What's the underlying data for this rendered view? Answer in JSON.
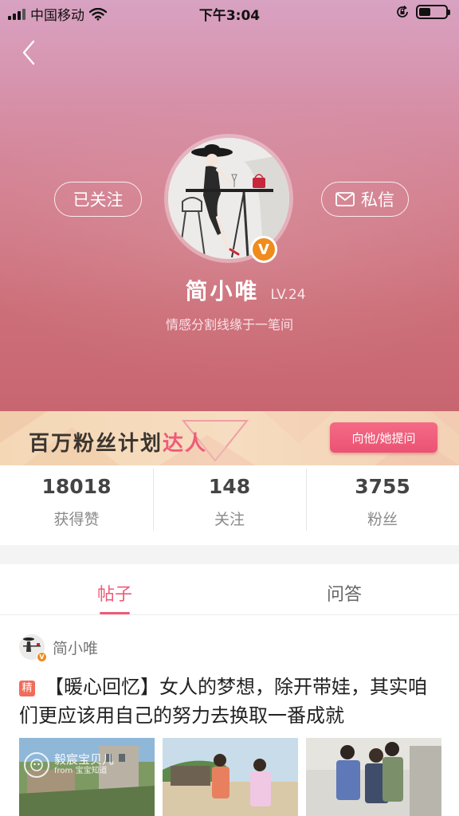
{
  "status_bar": {
    "carrier": "中国移动",
    "time": "下午3:04",
    "battery_level": 0.45
  },
  "profile": {
    "follow_label": "已关注",
    "message_label": "私信",
    "username": "简小唯",
    "level": "LV.24",
    "bio": "情感分割线缘于一笔间",
    "verified_badge": "V"
  },
  "banner": {
    "title_main": "百万粉丝计划",
    "title_highlight": "达人",
    "ask_button": "向他/她提问"
  },
  "stats": [
    {
      "value": "18018",
      "label": "获得赞"
    },
    {
      "value": "148",
      "label": "关注"
    },
    {
      "value": "3755",
      "label": "粉丝"
    }
  ],
  "tabs": [
    {
      "label": "帖子",
      "active": true
    },
    {
      "label": "问答",
      "active": false
    }
  ],
  "post": {
    "author": "简小唯",
    "tag": "精",
    "title": "【暖心回忆】女人的梦想，除开带娃，其实咱们更应该用自己的努力去换取一番成就",
    "watermark_main": "毅宸宝贝儿",
    "watermark_sub": "from 宝宝知道"
  },
  "icons": [
    "signal-icon",
    "wifi-icon",
    "lock-rotation-icon",
    "battery-icon",
    "back-arrow-icon",
    "mail-icon",
    "verified-icon"
  ],
  "colors": {
    "accent_pink": "#ee5b78",
    "verified_orange": "#ef8c1c",
    "header_top": "#d8a2c2",
    "header_bottom": "#c86670"
  }
}
